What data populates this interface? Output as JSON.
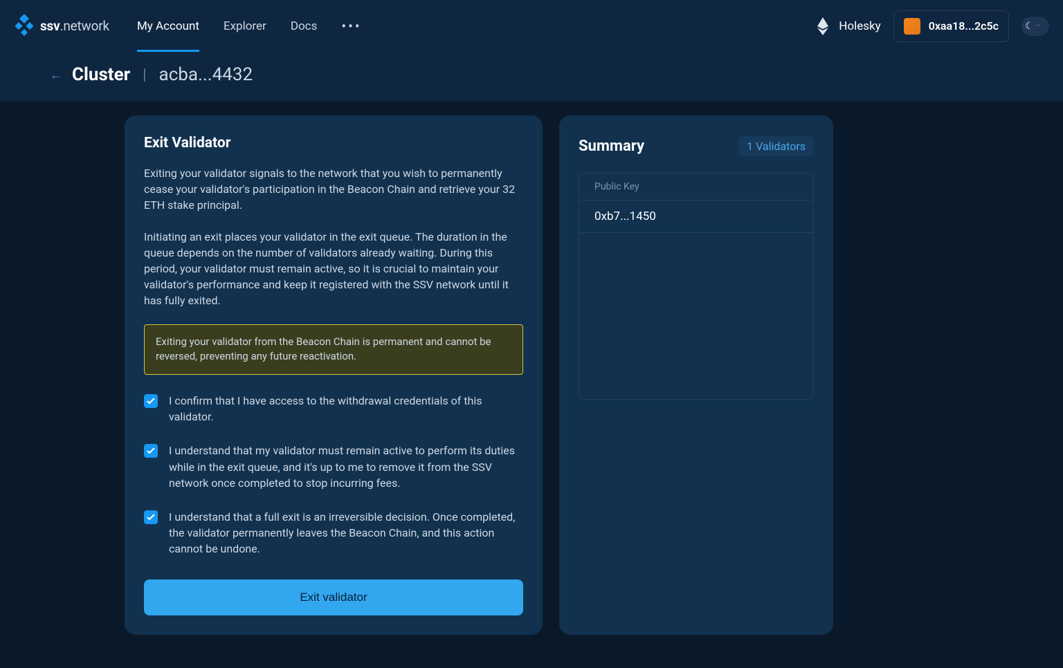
{
  "brand": {
    "prefix": "ssv",
    "suffix": ".network"
  },
  "nav": {
    "my_account": "My Account",
    "explorer": "Explorer",
    "docs": "Docs"
  },
  "network": {
    "name": "Holesky"
  },
  "wallet": {
    "address": "0xaa18...2c5c"
  },
  "breadcrumb": {
    "main": "Cluster",
    "separator": "|",
    "id": "acba...4432"
  },
  "exit": {
    "title": "Exit Validator",
    "para1": "Exiting your validator signals to the network that you wish to permanently cease your validator's participation in the Beacon Chain and retrieve your 32 ETH stake principal.",
    "para2": "Initiating an exit places your validator in the exit queue. The duration in the queue depends on the number of validators already waiting. During this period, your validator must remain active, so it is crucial to maintain your validator's performance and keep it registered with the SSV network until it has fully exited.",
    "warning": "Exiting your validator from the Beacon Chain is permanent and cannot be reversed, preventing any future reactivation.",
    "check1": "I confirm that I have access to the withdrawal credentials of this validator.",
    "check2": "I understand that my validator must remain active to perform its duties while in the exit queue, and it's up to me to remove it from the SSV network once completed to stop incurring fees.",
    "check3": "I understand that a full exit is an irreversible decision. Once completed, the validator permanently leaves the Beacon Chain, and this action cannot be undone.",
    "button": "Exit validator"
  },
  "summary": {
    "title": "Summary",
    "badge": "1 Validators",
    "header": "Public Key",
    "rows": [
      "0xb7...1450"
    ]
  }
}
